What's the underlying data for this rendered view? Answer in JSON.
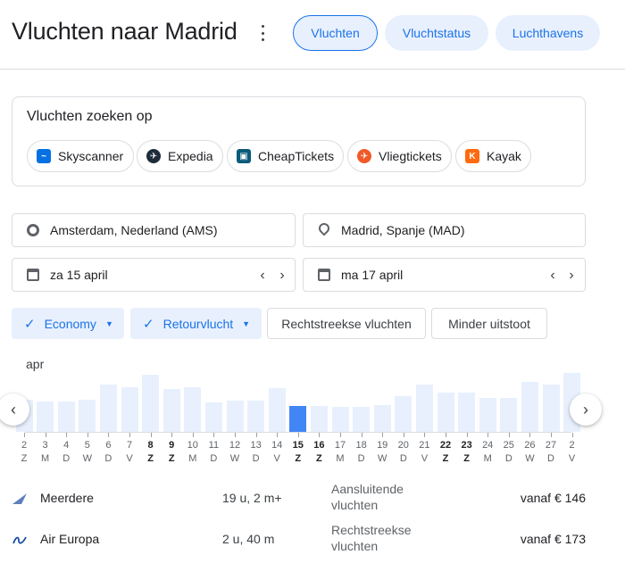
{
  "header": {
    "title": "Vluchten naar Madrid",
    "tabs": [
      {
        "label": "Vluchten",
        "active": true
      },
      {
        "label": "Vluchtstatus",
        "active": false
      },
      {
        "label": "Luchthavens",
        "active": false
      }
    ]
  },
  "search": {
    "title": "Vluchten zoeken op",
    "providers": [
      {
        "label": "Skyscanner",
        "icon": "skyscanner-icon",
        "color": "#0770e3"
      },
      {
        "label": "Expedia",
        "icon": "expedia-icon",
        "color": "#1f2b3a"
      },
      {
        "label": "CheapTickets",
        "icon": "cheaptickets-icon",
        "color": "#0a5a7a"
      },
      {
        "label": "Vliegtickets",
        "icon": "vliegtickets-icon",
        "color": "#f05a28"
      },
      {
        "label": "Kayak",
        "icon": "kayak-icon",
        "color": "#ff690f"
      }
    ]
  },
  "form": {
    "origin": "Amsterdam, Nederland (AMS)",
    "destination": "Madrid, Spanje (MAD)",
    "depart_date": "za 15 april",
    "return_date": "ma 17 april"
  },
  "filters": {
    "cabin": "Economy",
    "trip_type": "Retourvlucht",
    "direct": "Rechtstreekse vluchten",
    "emissions": "Minder uitstoot"
  },
  "calendar": {
    "month": "apr",
    "selected_day": "15",
    "days": [
      {
        "n": "2",
        "w": "Z",
        "bold": false,
        "level": 0.48
      },
      {
        "n": "3",
        "w": "M",
        "bold": false,
        "level": 0.45
      },
      {
        "n": "4",
        "w": "D",
        "bold": false,
        "level": 0.45
      },
      {
        "n": "5",
        "w": "W",
        "bold": false,
        "level": 0.48
      },
      {
        "n": "6",
        "w": "D",
        "bold": false,
        "level": 0.7
      },
      {
        "n": "7",
        "w": "V",
        "bold": false,
        "level": 0.66
      },
      {
        "n": "8",
        "w": "Z",
        "bold": true,
        "level": 0.85
      },
      {
        "n": "9",
        "w": "Z",
        "bold": true,
        "level": 0.64
      },
      {
        "n": "10",
        "w": "M",
        "bold": false,
        "level": 0.67
      },
      {
        "n": "11",
        "w": "D",
        "bold": false,
        "level": 0.44
      },
      {
        "n": "12",
        "w": "W",
        "bold": false,
        "level": 0.47
      },
      {
        "n": "13",
        "w": "D",
        "bold": false,
        "level": 0.47
      },
      {
        "n": "14",
        "w": "V",
        "bold": false,
        "level": 0.65
      },
      {
        "n": "15",
        "w": "Z",
        "bold": true,
        "level": 0.38
      },
      {
        "n": "16",
        "w": "Z",
        "bold": true,
        "level": 0.39
      },
      {
        "n": "17",
        "w": "M",
        "bold": false,
        "level": 0.37
      },
      {
        "n": "18",
        "w": "D",
        "bold": false,
        "level": 0.37
      },
      {
        "n": "19",
        "w": "W",
        "bold": false,
        "level": 0.4
      },
      {
        "n": "20",
        "w": "D",
        "bold": false,
        "level": 0.53
      },
      {
        "n": "21",
        "w": "V",
        "bold": false,
        "level": 0.71
      },
      {
        "n": "22",
        "w": "Z",
        "bold": true,
        "level": 0.58
      },
      {
        "n": "23",
        "w": "Z",
        "bold": true,
        "level": 0.58
      },
      {
        "n": "24",
        "w": "M",
        "bold": false,
        "level": 0.5
      },
      {
        "n": "25",
        "w": "D",
        "bold": false,
        "level": 0.5
      },
      {
        "n": "26",
        "w": "W",
        "bold": false,
        "level": 0.74
      },
      {
        "n": "27",
        "w": "D",
        "bold": false,
        "level": 0.71
      },
      {
        "n": "2",
        "w": "V",
        "bold": false,
        "level": 0.88
      }
    ]
  },
  "results": [
    {
      "airline": "Meerdere",
      "icon": "multiple-airlines-icon",
      "duration": "19 u, 2 m+",
      "type": "Aansluitende vluchten",
      "price": "vanaf € 146"
    },
    {
      "airline": "Air Europa",
      "icon": "air-europa-icon",
      "duration": "2 u, 40 m",
      "type": "Rechtstreekse vluchten",
      "price": "vanaf € 173"
    }
  ],
  "colors": {
    "accent": "#1a73e8",
    "bar": "#e8f0fe",
    "bar_selected": "#4285f4"
  }
}
